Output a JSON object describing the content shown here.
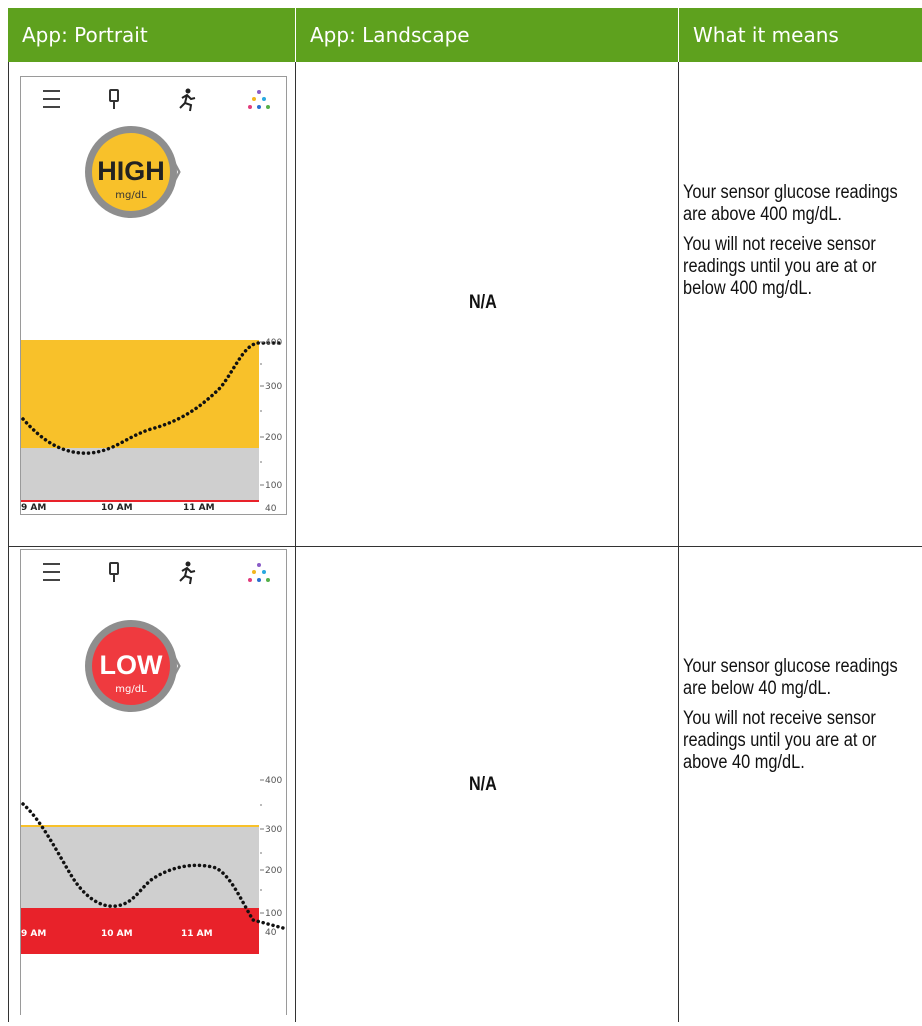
{
  "table": {
    "headers": [
      "App: Portrait",
      "App: Landscape",
      "What it means"
    ],
    "rows": [
      {
        "status_text": "HIGH",
        "status_unit": "mg/dL",
        "landscape": "N/A",
        "meaning": [
          "Your sensor glucose readings are above 400 mg/dL.",
          "You will not receive sensor readings until you are at or below 400 mg/dL."
        ],
        "y_ticks": [
          "400",
          "300",
          "200",
          "100",
          "40"
        ],
        "x_ticks": [
          "9 AM",
          "10 AM",
          "11 AM"
        ],
        "badge_color": "#f8c12a"
      },
      {
        "status_text": "LOW",
        "status_unit": "mg/dL",
        "landscape": "N/A",
        "meaning": [
          "Your sensor glucose readings are below 40 mg/dL.",
          "You will not receive sensor readings until you are at or above 40 mg/dL."
        ],
        "y_ticks": [
          "400",
          "300",
          "200",
          "100",
          "40"
        ],
        "x_ticks": [
          "9 AM",
          "10 AM",
          "11 AM"
        ],
        "badge_color": "#ef3a3f"
      }
    ]
  },
  "icons": [
    "menu-icon",
    "blood-drop-meter-icon",
    "running-person-icon",
    "multicolor-dots-icon"
  ],
  "colors": {
    "header_bg": "#5ea11e",
    "high_zone": "#f8c12a",
    "target_zone": "#cfcfcf",
    "low_zone": "#e8222a"
  }
}
